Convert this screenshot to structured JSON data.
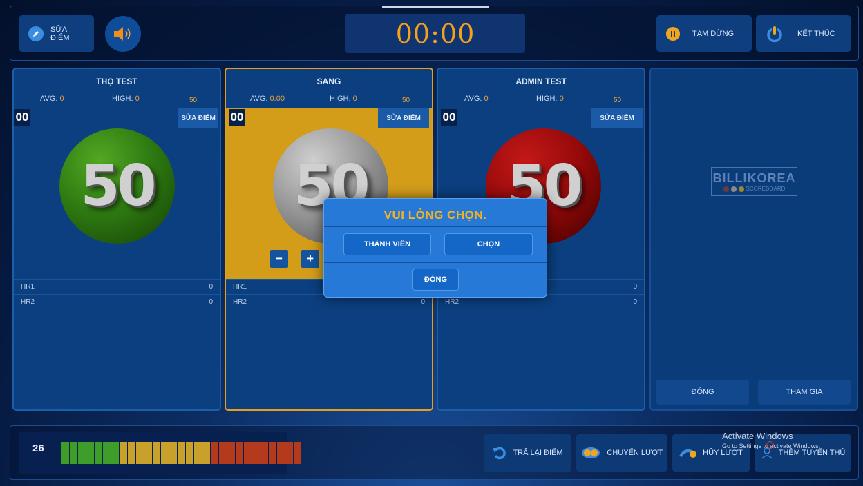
{
  "header": {
    "edit_score_label": "SỬA ĐIỂM",
    "timer": "00:00",
    "pause_label": "TẠM DỪNG",
    "end_label": "KẾT THÚC"
  },
  "players": [
    {
      "name": "THỌ TEST",
      "avg_label": "AVG:",
      "avg": "0",
      "high_label": "HIGH:",
      "high": "0",
      "target": "50",
      "turn": "00",
      "edit_label": "SỬA ĐIỂM",
      "score": "50",
      "hr1_label": "HR1",
      "hr1": "0",
      "hr2_label": "HR2",
      "hr2": "0"
    },
    {
      "name": "SANG",
      "avg_label": "AVG:",
      "avg": "0.00",
      "high_label": "HIGH:",
      "high": "0",
      "target": "50",
      "turn": "00",
      "edit_label": "SỬA ĐIỂM",
      "score": "50",
      "minus": "−",
      "plus": "+",
      "hr1_label": "HR1",
      "hr2_label": "HR2",
      "hr2": "0"
    },
    {
      "name": "ADMIN TEST",
      "avg_label": "AVG:",
      "avg": "0",
      "high_label": "HIGH:",
      "high": "0",
      "target": "50",
      "turn": "00",
      "edit_label": "SỬA ĐIỂM",
      "score": "50",
      "hr1": "0",
      "hr2_label": "HR2",
      "hr2": "0"
    }
  ],
  "side": {
    "logo_title": "BILLIKOREA",
    "logo_sub": "SCOREBOARD",
    "close_label": "ĐÓNG",
    "join_label": "THAM GIA"
  },
  "footer": {
    "count": "26",
    "bar_colors": {
      "green": "#3f9d2a",
      "yellow": "#c7a12a",
      "red": "#b33a1c"
    },
    "bar_segments": {
      "green": 7,
      "yellow": 11,
      "red": 11
    },
    "return_score": "TRẢ LẠI ĐIỂM",
    "switch_turn": "CHUYỂN LƯỢT",
    "cancel_turn": "HỦY LƯỢT",
    "add_player": "THÊM TUYỂN THỦ"
  },
  "windows_watermark": {
    "title": "Activate Windows",
    "subtitle": "Go to Settings to activate Windows."
  },
  "dialog": {
    "title": "VUI LÒNG CHỌN.",
    "member_label": "THÀNH VIÊN",
    "select_label": "CHỌN",
    "close_label": "ĐÓNG"
  },
  "colors": {
    "accent_orange": "#f5a11c",
    "panel_blue": "#0b3f7f",
    "active_panel": "#d39d1a"
  }
}
